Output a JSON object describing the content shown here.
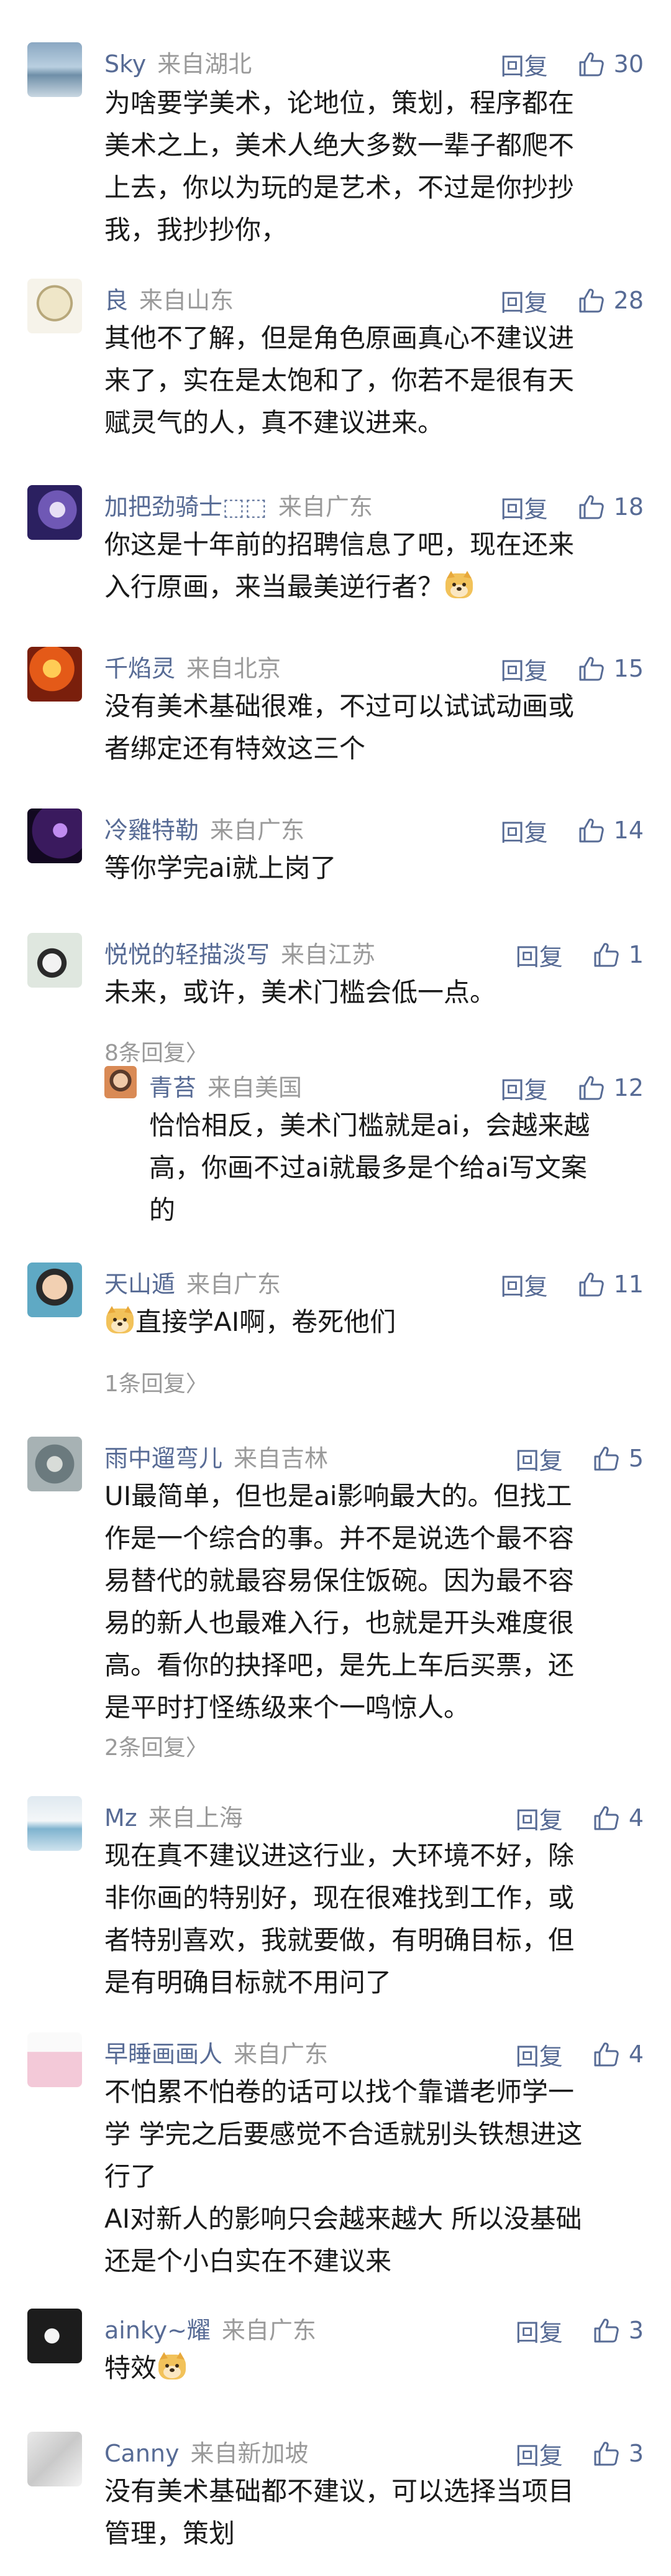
{
  "comments": [
    {
      "name": "Sky",
      "from": "来自湖北",
      "reply": "回复",
      "likes": "30",
      "lines": [
        "为啥要学美术，论地位，策划，程序都在",
        "美术之上，美术人绝大多数一辈子都爬不",
        "上去，你以为玩的是艺术，不过是你抄抄",
        "我，我抄抄你，"
      ]
    },
    {
      "name": "良",
      "from": "来自山东",
      "reply": "回复",
      "likes": "28",
      "lines": [
        "其他不了解，但是角色原画真心不建议进",
        "来了，实在是太饱和了，你若不是很有天",
        "赋灵气的人，真不建议进来。"
      ]
    },
    {
      "name": "加把劲骑士⬚⬚",
      "from": "来自广东",
      "reply": "回复",
      "likes": "18",
      "lines": [
        "你这是十年前的招聘信息了吧，现在还来",
        "入行原画，来当最美逆行者？"
      ]
    },
    {
      "name": "千焰灵",
      "from": "来自北京",
      "reply": "回复",
      "likes": "15",
      "lines": [
        "没有美术基础很难，不过可以试试动画或",
        "者绑定还有特效这三个"
      ]
    },
    {
      "name": "冷雞特勒",
      "from": "来自广东",
      "reply": "回复",
      "likes": "14",
      "lines": [
        "等你学完ai就上岗了"
      ]
    },
    {
      "name": "悦悦的轻描淡写",
      "from": "来自江苏",
      "reply": "回复",
      "likes": "1",
      "lines": [
        "未来，或许，美术门槛会低一点。"
      ],
      "more": "8条回复〉"
    },
    {
      "name": "青苔",
      "from": "来自美国",
      "reply": "回复",
      "likes": "12",
      "lines": [
        "恰恰相反，美术门槛就是ai，会越来越",
        "高，你画不过ai就最多是个给ai写文案",
        "的"
      ]
    },
    {
      "name": "天山遁",
      "from": "来自广东",
      "reply": "回复",
      "likes": "11",
      "lines": [
        "直接学AI啊，卷死他们"
      ],
      "more": "1条回复〉"
    },
    {
      "name": "雨中遛弯儿",
      "from": "来自吉林",
      "reply": "回复",
      "likes": "5",
      "lines": [
        "UI最简单，但也是ai影响最大的。但找工",
        "作是一个综合的事。并不是说选个最不容",
        "易替代的就最容易保住饭碗。因为最不容",
        "易的新人也最难入行，也就是开头难度很",
        "高。看你的抉择吧，是先上车后买票，还",
        "是平时打怪练级来个一鸣惊人。"
      ],
      "more": "2条回复〉"
    },
    {
      "name": "Mz",
      "from": "来自上海",
      "reply": "回复",
      "likes": "4",
      "lines": [
        "现在真不建议进这行业，大环境不好，除",
        "非你画的特别好，现在很难找到工作，或",
        "者特别喜欢，我就要做，有明确目标，但",
        "是有明确目标就不用问了"
      ]
    },
    {
      "name": "早睡画画人",
      "from": "来自广东",
      "reply": "回复",
      "likes": "4",
      "lines": [
        "不怕累不怕卷的话可以找个靠谱老师学一",
        "学 学完之后要感觉不合适就别头铁想进这",
        "行了",
        "AI对新人的影响只会越来越大 所以没基础",
        "还是个小白实在不建议来"
      ]
    },
    {
      "name": "ainky~耀",
      "from": "来自广东",
      "reply": "回复",
      "likes": "3",
      "lines": [
        "特效"
      ]
    },
    {
      "name": "Canny",
      "from": "来自新加坡",
      "reply": "回复",
      "likes": "3",
      "lines": [
        "没有美术基础都不建议，可以选择当项目",
        "管理，策划"
      ]
    }
  ],
  "icons": {
    "like": "thumb-up-icon",
    "emoji": "doge-emoji-icon"
  },
  "colors": {
    "name": "#576b95",
    "meta": "#9a9a9a",
    "text": "#1a1a1a"
  }
}
